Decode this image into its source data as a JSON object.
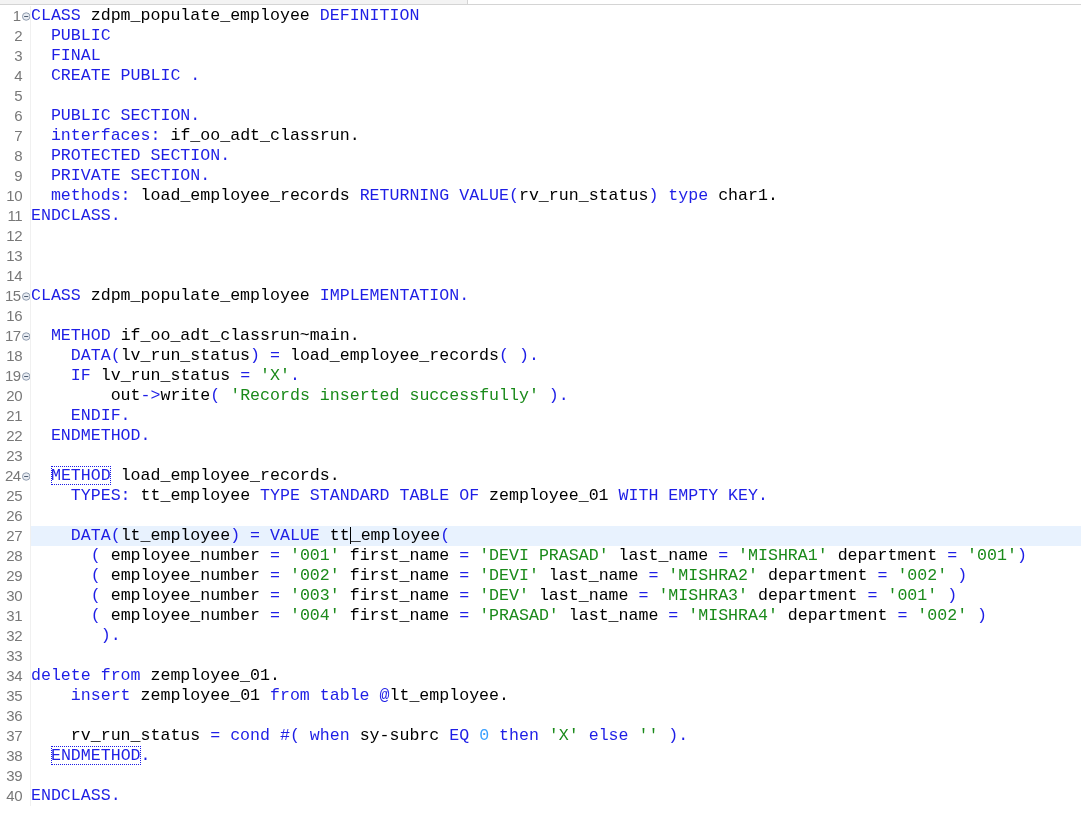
{
  "lines": [
    {
      "number": "1",
      "fold": true,
      "current": false,
      "tokens": [
        {
          "kind": "kw",
          "text": "CLASS "
        },
        {
          "kind": "id",
          "text": "zdpm_populate_employee "
        },
        {
          "kind": "kw",
          "text": "DEFINITION"
        }
      ]
    },
    {
      "number": "2",
      "fold": false,
      "current": false,
      "tokens": [
        {
          "kind": "kw",
          "text": "  PUBLIC"
        }
      ]
    },
    {
      "number": "3",
      "fold": false,
      "current": false,
      "tokens": [
        {
          "kind": "kw",
          "text": "  FINAL"
        }
      ]
    },
    {
      "number": "4",
      "fold": false,
      "current": false,
      "tokens": [
        {
          "kind": "kw",
          "text": "  CREATE PUBLIC ."
        }
      ]
    },
    {
      "number": "5",
      "fold": false,
      "current": false
    },
    {
      "number": "6",
      "fold": false,
      "current": false,
      "tokens": [
        {
          "kind": "kw",
          "text": "  PUBLIC SECTION."
        }
      ]
    },
    {
      "number": "7",
      "fold": false,
      "current": false,
      "tokens": [
        {
          "kind": "kw",
          "text": "  interfaces: "
        },
        {
          "kind": "id",
          "text": "if_oo_adt_classrun."
        }
      ]
    },
    {
      "number": "8",
      "fold": false,
      "current": false,
      "tokens": [
        {
          "kind": "kw",
          "text": "  PROTECTED SECTION."
        }
      ]
    },
    {
      "number": "9",
      "fold": false,
      "current": false,
      "tokens": [
        {
          "kind": "kw",
          "text": "  PRIVATE SECTION."
        }
      ]
    },
    {
      "number": "10",
      "fold": false,
      "current": false,
      "tokens": [
        {
          "kind": "kw",
          "text": "  methods: "
        },
        {
          "kind": "id",
          "text": "load_employee_records "
        },
        {
          "kind": "kw",
          "text": "RETURNING VALUE("
        },
        {
          "kind": "id",
          "text": "rv_run_status"
        },
        {
          "kind": "kw",
          "text": ") type "
        },
        {
          "kind": "id",
          "text": "char1."
        }
      ]
    },
    {
      "number": "11",
      "fold": false,
      "current": false,
      "tokens": [
        {
          "kind": "kw",
          "text": "ENDCLASS."
        }
      ]
    },
    {
      "number": "12",
      "fold": false,
      "current": false
    },
    {
      "number": "13",
      "fold": false,
      "current": false
    },
    {
      "number": "14",
      "fold": false,
      "current": false
    },
    {
      "number": "15",
      "fold": true,
      "current": false,
      "tokens": [
        {
          "kind": "kw",
          "text": "CLASS "
        },
        {
          "kind": "id",
          "text": "zdpm_populate_employee "
        },
        {
          "kind": "kw",
          "text": "IMPLEMENTATION."
        }
      ]
    },
    {
      "number": "16",
      "fold": false,
      "current": false
    },
    {
      "number": "17",
      "fold": true,
      "current": false,
      "tokens": [
        {
          "kind": "kw",
          "text": "  METHOD "
        },
        {
          "kind": "id",
          "text": "if_oo_adt_classrun~main."
        }
      ]
    },
    {
      "number": "18",
      "fold": false,
      "current": false,
      "tokens": [
        {
          "kind": "kw",
          "text": "    DATA("
        },
        {
          "kind": "id",
          "text": "lv_run_status"
        },
        {
          "kind": "kw",
          "text": ") = "
        },
        {
          "kind": "id",
          "text": "load_employee_records"
        },
        {
          "kind": "kw",
          "text": "( )."
        }
      ]
    },
    {
      "number": "19",
      "fold": true,
      "current": false,
      "tokens": [
        {
          "kind": "kw",
          "text": "    IF "
        },
        {
          "kind": "id",
          "text": "lv_run_status "
        },
        {
          "kind": "kw",
          "text": "= "
        },
        {
          "kind": "str",
          "text": "'X'"
        },
        {
          "kind": "kw",
          "text": "."
        }
      ]
    },
    {
      "number": "20",
      "fold": false,
      "current": false,
      "tokens": [
        {
          "kind": "id",
          "text": "        out"
        },
        {
          "kind": "kw",
          "text": "->"
        },
        {
          "kind": "id",
          "text": "write"
        },
        {
          "kind": "kw",
          "text": "( "
        },
        {
          "kind": "str",
          "text": "'Records inserted successfully'"
        },
        {
          "kind": "kw",
          "text": " )."
        }
      ]
    },
    {
      "number": "21",
      "fold": false,
      "current": false,
      "tokens": [
        {
          "kind": "kw",
          "text": "    ENDIF."
        }
      ]
    },
    {
      "number": "22",
      "fold": false,
      "current": false,
      "tokens": [
        {
          "kind": "kw",
          "text": "  ENDMETHOD."
        }
      ]
    },
    {
      "number": "23",
      "fold": false,
      "current": false
    },
    {
      "number": "24",
      "fold": true,
      "current": false,
      "tokens": [
        {
          "kind": "match",
          "text": "  METHOD"
        },
        {
          "kind": "id",
          "text": " load_employee_records."
        }
      ]
    },
    {
      "number": "25",
      "fold": false,
      "current": false,
      "tokens": [
        {
          "kind": "kw",
          "text": "    TYPES: "
        },
        {
          "kind": "id",
          "text": "tt_employee "
        },
        {
          "kind": "kw",
          "text": "TYPE STANDARD TABLE OF "
        },
        {
          "kind": "id",
          "text": "zemployee_01 "
        },
        {
          "kind": "kw",
          "text": "WITH EMPTY KEY."
        }
      ]
    },
    {
      "number": "26",
      "fold": false,
      "current": false
    },
    {
      "number": "27",
      "fold": false,
      "current": true,
      "tokens": [
        {
          "kind": "kw",
          "text": "    DATA("
        },
        {
          "kind": "id",
          "text": "lt_employee"
        },
        {
          "kind": "kw",
          "text": ") = VALUE "
        },
        {
          "kind": "id",
          "text": "tt"
        },
        {
          "kind": "caret"
        },
        {
          "kind": "id",
          "text": "_employee"
        },
        {
          "kind": "kw",
          "text": "("
        }
      ]
    },
    {
      "number": "28",
      "fold": false,
      "current": false,
      "tokens": [
        {
          "kind": "kw",
          "text": "      ( "
        },
        {
          "kind": "id",
          "text": "employee_number "
        },
        {
          "kind": "kw",
          "text": "= "
        },
        {
          "kind": "str",
          "text": "'001'"
        },
        {
          "kind": "id",
          "text": " first_name "
        },
        {
          "kind": "kw",
          "text": "= "
        },
        {
          "kind": "str",
          "text": "'DEVI PRASAD'"
        },
        {
          "kind": "id",
          "text": " last_name "
        },
        {
          "kind": "kw",
          "text": "= "
        },
        {
          "kind": "str",
          "text": "'MISHRA1'"
        },
        {
          "kind": "id",
          "text": " department "
        },
        {
          "kind": "kw",
          "text": "= "
        },
        {
          "kind": "str",
          "text": "'001'"
        },
        {
          "kind": "kw",
          "text": ")"
        }
      ]
    },
    {
      "number": "29",
      "fold": false,
      "current": false,
      "tokens": [
        {
          "kind": "kw",
          "text": "      ( "
        },
        {
          "kind": "id",
          "text": "employee_number "
        },
        {
          "kind": "kw",
          "text": "= "
        },
        {
          "kind": "str",
          "text": "'002'"
        },
        {
          "kind": "id",
          "text": " first_name "
        },
        {
          "kind": "kw",
          "text": "= "
        },
        {
          "kind": "str",
          "text": "'DEVI'"
        },
        {
          "kind": "id",
          "text": " last_name "
        },
        {
          "kind": "kw",
          "text": "= "
        },
        {
          "kind": "str",
          "text": "'MISHRA2'"
        },
        {
          "kind": "id",
          "text": " department "
        },
        {
          "kind": "kw",
          "text": "= "
        },
        {
          "kind": "str",
          "text": "'002'"
        },
        {
          "kind": "kw",
          "text": " )"
        }
      ]
    },
    {
      "number": "30",
      "fold": false,
      "current": false,
      "tokens": [
        {
          "kind": "kw",
          "text": "      ( "
        },
        {
          "kind": "id",
          "text": "employee_number "
        },
        {
          "kind": "kw",
          "text": "= "
        },
        {
          "kind": "str",
          "text": "'003'"
        },
        {
          "kind": "id",
          "text": " first_name "
        },
        {
          "kind": "kw",
          "text": "= "
        },
        {
          "kind": "str",
          "text": "'DEV'"
        },
        {
          "kind": "id",
          "text": " last_name "
        },
        {
          "kind": "kw",
          "text": "= "
        },
        {
          "kind": "str",
          "text": "'MISHRA3'"
        },
        {
          "kind": "id",
          "text": " department "
        },
        {
          "kind": "kw",
          "text": "= "
        },
        {
          "kind": "str",
          "text": "'001'"
        },
        {
          "kind": "kw",
          "text": " )"
        }
      ]
    },
    {
      "number": "31",
      "fold": false,
      "current": false,
      "tokens": [
        {
          "kind": "kw",
          "text": "      ( "
        },
        {
          "kind": "id",
          "text": "employee_number "
        },
        {
          "kind": "kw",
          "text": "= "
        },
        {
          "kind": "str",
          "text": "'004'"
        },
        {
          "kind": "id",
          "text": " first_name "
        },
        {
          "kind": "kw",
          "text": "= "
        },
        {
          "kind": "str",
          "text": "'PRASAD'"
        },
        {
          "kind": "id",
          "text": " last_name "
        },
        {
          "kind": "kw",
          "text": "= "
        },
        {
          "kind": "str",
          "text": "'MISHRA4'"
        },
        {
          "kind": "id",
          "text": " department "
        },
        {
          "kind": "kw",
          "text": "= "
        },
        {
          "kind": "str",
          "text": "'002'"
        },
        {
          "kind": "kw",
          "text": " )"
        }
      ]
    },
    {
      "number": "32",
      "fold": false,
      "current": false,
      "tokens": [
        {
          "kind": "kw",
          "text": "       )."
        }
      ]
    },
    {
      "number": "33",
      "fold": false,
      "current": false
    },
    {
      "number": "34",
      "fold": false,
      "current": false,
      "tokens": [
        {
          "kind": "kw",
          "text": "delete from "
        },
        {
          "kind": "id",
          "text": "zemployee_01."
        }
      ]
    },
    {
      "number": "35",
      "fold": false,
      "current": false,
      "tokens": [
        {
          "kind": "kw",
          "text": "    insert "
        },
        {
          "kind": "id",
          "text": "zemployee_01 "
        },
        {
          "kind": "kw",
          "text": "from table @"
        },
        {
          "kind": "id",
          "text": "lt_employee."
        }
      ]
    },
    {
      "number": "36",
      "fold": false,
      "current": false
    },
    {
      "number": "37",
      "fold": false,
      "current": false,
      "tokens": [
        {
          "kind": "id",
          "text": "    rv_run_status "
        },
        {
          "kind": "kw",
          "text": "= cond #( when "
        },
        {
          "kind": "id",
          "text": "sy-subrc "
        },
        {
          "kind": "kw",
          "text": "EQ "
        },
        {
          "kind": "num",
          "text": "0"
        },
        {
          "kind": "kw",
          "text": " then "
        },
        {
          "kind": "str",
          "text": "'X'"
        },
        {
          "kind": "kw",
          "text": " else "
        },
        {
          "kind": "str",
          "text": "''"
        },
        {
          "kind": "kw",
          "text": " )."
        }
      ]
    },
    {
      "number": "38",
      "fold": false,
      "current": false,
      "tokens": [
        {
          "kind": "match",
          "text": "  ENDMETHOD"
        },
        {
          "kind": "kw",
          "text": "."
        }
      ]
    },
    {
      "number": "39",
      "fold": false,
      "current": false
    },
    {
      "number": "40",
      "fold": false,
      "current": false,
      "tokens": [
        {
          "kind": "kw",
          "text": "ENDCLASS."
        }
      ]
    }
  ]
}
